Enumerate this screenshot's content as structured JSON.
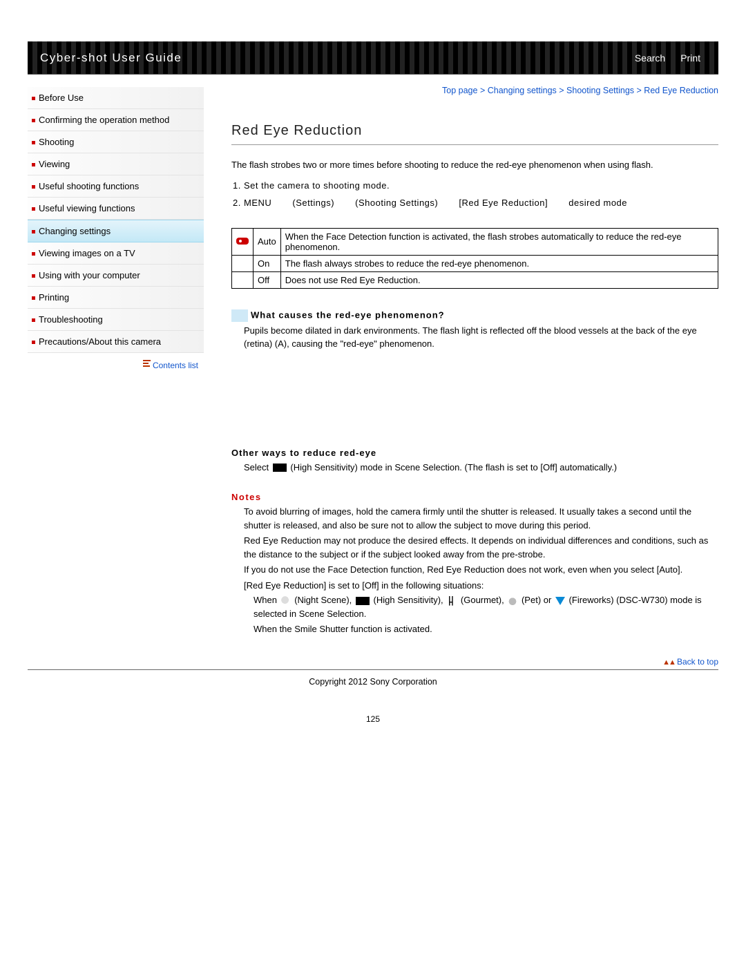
{
  "header": {
    "title": "Cyber-shot User Guide",
    "search_label": "Search",
    "print_label": "Print"
  },
  "sidebar": {
    "items": [
      {
        "label": "Before Use"
      },
      {
        "label": "Confirming the operation method"
      },
      {
        "label": "Shooting"
      },
      {
        "label": "Viewing"
      },
      {
        "label": "Useful shooting functions"
      },
      {
        "label": "Useful viewing functions"
      },
      {
        "label": "Changing settings",
        "active": true
      },
      {
        "label": "Viewing images on a TV"
      },
      {
        "label": "Using with your computer"
      },
      {
        "label": "Printing"
      },
      {
        "label": "Troubleshooting"
      },
      {
        "label": "Precautions/About this camera"
      }
    ],
    "contents_list_label": "Contents list"
  },
  "breadcrumb": {
    "items": [
      "Top page",
      "Changing settings",
      "Shooting Settings",
      "Red Eye Reduction"
    ],
    "sep": " > "
  },
  "page": {
    "title": "Red Eye Reduction",
    "lead": "The flash strobes two or more times before shooting to reduce the red-eye phenomenon when using flash.",
    "steps": [
      "Set the camera to shooting mode.",
      ""
    ],
    "menu_path": {
      "menu": "MENU",
      "settings": "(Settings)",
      "shooting": "(Shooting Settings)",
      "item": "[Red Eye Reduction]",
      "desired": "desired mode"
    },
    "options": [
      {
        "icon": true,
        "name": "Auto",
        "desc": "When the Face Detection function is activated, the flash strobes automatically to reduce the red-eye phenomenon."
      },
      {
        "icon": false,
        "name": "On",
        "desc": "The flash always strobes to reduce the red-eye phenomenon."
      },
      {
        "icon": false,
        "name": "Off",
        "desc": "Does not use Red Eye Reduction."
      }
    ],
    "info_heading": "What causes the red-eye phenomenon?",
    "info_body": "Pupils become dilated in dark environments. The flash light is reflected off the blood vessels at the back of the eye (retina) (A), causing the \"red-eye\" phenomenon.",
    "sub_heading": "Other ways to reduce red-eye",
    "other_ways_prefix": "Select ",
    "other_ways_suffix": " (High Sensitivity) mode in Scene Selection. (The flash is set to [Off] automatically.)",
    "notes_title": "Notes",
    "notes": [
      "To avoid blurring of images, hold the camera firmly until the shutter is released. It usually takes a second until the shutter is released, and also be sure not to allow the subject to move during this period.",
      "Red Eye Reduction may not produce the desired effects. It depends on individual differences and conditions, such as the distance to the subject or if the subject looked away from the pre-strobe.",
      "If you do not use the Face Detection function, Red Eye Reduction does not work, even when you select [Auto].",
      "[Red Eye Reduction] is set to [Off] in the following situations:"
    ],
    "notes_sub": {
      "line1_prefix": "When ",
      "night": " (Night Scene), ",
      "high_sens": " (High Sensitivity), ",
      "gourmet": " (Gourmet), ",
      "pet": " (Pet) or ",
      "fireworks": " (Fireworks) (DSC-W730) mode is selected in Scene Selection.",
      "line2": "When the Smile Shutter function is activated."
    },
    "back_to_top": "Back to top",
    "copyright": "Copyright 2012 Sony Corporation",
    "page_number": "125"
  }
}
